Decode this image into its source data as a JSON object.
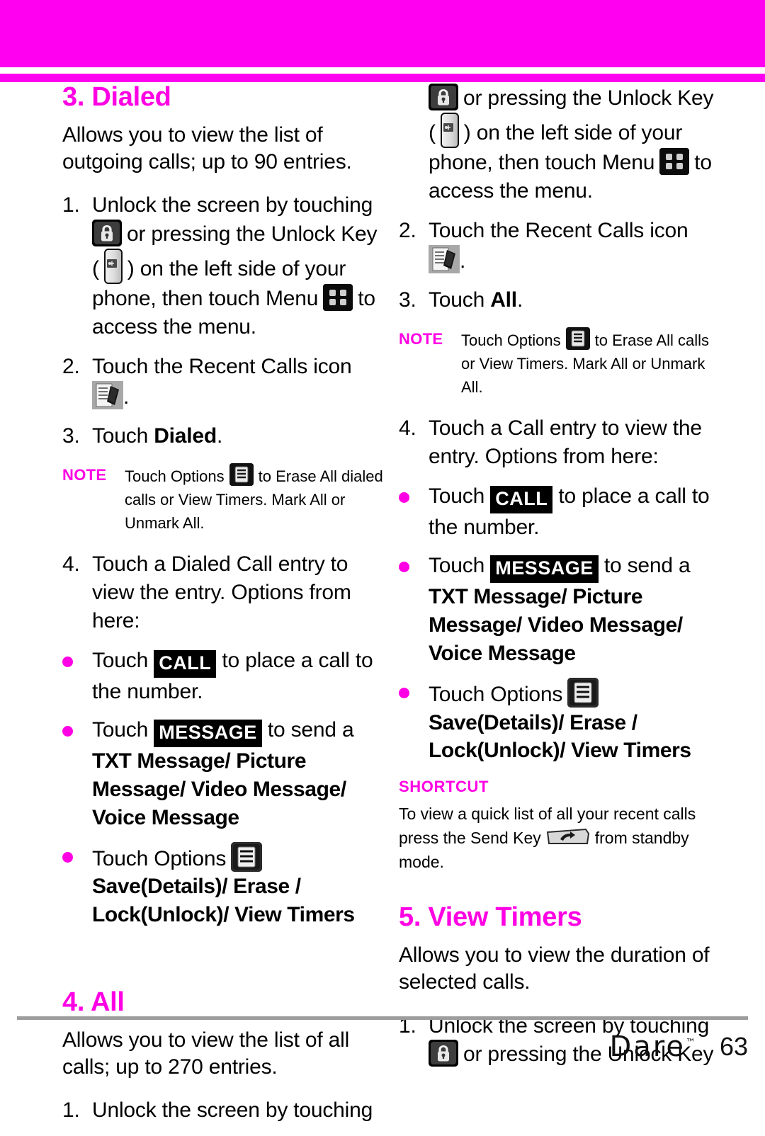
{
  "header": {
    "band_color": "#ff00f0",
    "rule_color": "#ff00f0"
  },
  "accent_color": "#ff00e4",
  "left_column": {
    "section_title": "3. Dialed",
    "intro": "Allows you to view the list of outgoing calls; up to 90 entries.",
    "step1_num": "1.",
    "step1_part1": "Unlock the screen by touching",
    "step1_part2": "or pressing the Unlock Key",
    "step1_part3": "(",
    "step1_part4": ") on the left side of your phone, then touch Menu",
    "step1_part5": "to access the menu.",
    "step2_num": "2.",
    "step2_part1": "Touch the Recent Calls icon",
    "step2_part2": ".",
    "step3_num": "3.",
    "step3_part1": "Touch",
    "step3_bold": "Dialed",
    "step3_part2": ".",
    "note_tag": "NOTE",
    "note_part1": "Touch Options",
    "note_part2": "to Erase All dialed calls or View Timers. Mark All or Unmark All.",
    "step4_num": "4.",
    "step4_text": "Touch a Dialed Call entry to view the entry. Options from here:",
    "bullet1_part1": "Touch",
    "bullet1_kbd": "CALL",
    "bullet1_part2": "to place a call to the number.",
    "bullet2_part1": "Touch",
    "bullet2_kbd": "MESSAGE",
    "bullet2_part2": "to send a",
    "bullet2_bold": "TXT Message/ Picture Message/ Video Message/ Voice Message",
    "bullet3_part1": "Touch Options",
    "bullet3_bold": "Save(Details)/ Erase / Lock(Unlock)/ View Timers",
    "section2_title": "4. All",
    "section2_intro": "Allows you to view the list of all calls; up to 270 entries.",
    "section2_step1_num": "1.",
    "section2_step1_text": "Unlock the screen by touching"
  },
  "right_column": {
    "cont_part1": "or pressing the Unlock Key",
    "cont_part2": "(",
    "cont_part3": ") on the left side of your phone, then touch Menu",
    "cont_part4": "to access the menu.",
    "step2_num": "2.",
    "step2_part1": "Touch the Recent Calls icon",
    "step2_part2": ".",
    "step3_num": "3.",
    "step3_part1": "Touch",
    "step3_bold": "All",
    "step3_part2": ".",
    "note_tag": "NOTE",
    "note_part1": "Touch Options",
    "note_part2": "to Erase All calls or View Timers. Mark All or Unmark All.",
    "step4_num": "4.",
    "step4_text": "Touch a Call entry to view the entry. Options from here:",
    "bullet1_part1": "Touch",
    "bullet1_kbd": "CALL",
    "bullet1_part2": "to place a call to the number.",
    "bullet2_part1": "Touch",
    "bullet2_kbd": "MESSAGE",
    "bullet2_part2": "to send a",
    "bullet2_bold": "TXT Message/ Picture Message/ Video Message/ Voice Message",
    "bullet3_part1": "Touch Options",
    "bullet3_bold": "Save(Details)/ Erase / Lock(Unlock)/ View Timers",
    "shortcut_tag": "SHORTCUT",
    "shortcut_part1": "To view a quick list of all your recent calls press the Send Key",
    "shortcut_part2": "from standby mode.",
    "section2_title": "5. View Timers",
    "section2_intro": "Allows you to view the duration of selected calls.",
    "section2_step1_num": "1.",
    "section2_step1_part1": "Unlock the screen by touching",
    "section2_step1_part2": "or pressing the Unlock Key"
  },
  "footer": {
    "brand": "Dare",
    "brand_tm": "™",
    "page_number": "63"
  },
  "icons": {
    "lock": "lock-icon",
    "unlock_key": "unlock-key-icon",
    "menu": "menu-grid-icon",
    "recent_calls": "recent-calls-icon",
    "options": "options-list-icon",
    "send_key": "send-key-icon"
  }
}
